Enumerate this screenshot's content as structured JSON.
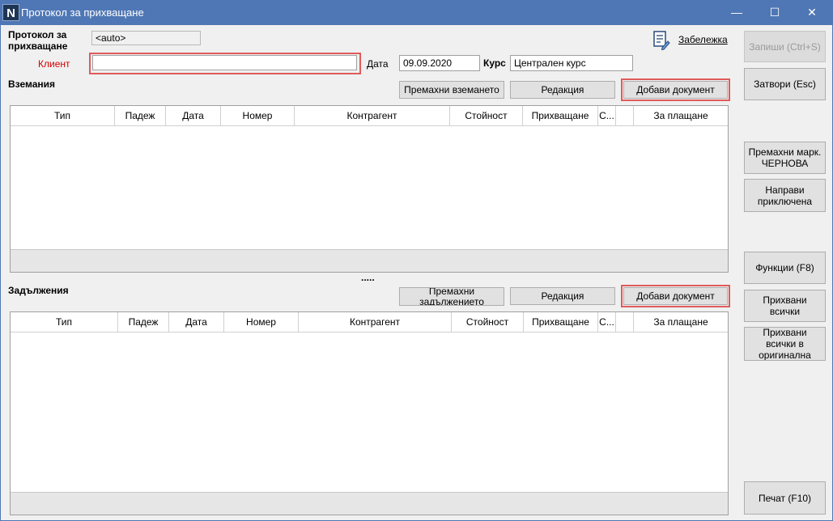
{
  "window": {
    "title": "Протокол за прихващане",
    "app_icon_letter": "N",
    "minimize_glyph": "—",
    "maximize_glyph": "☐",
    "close_glyph": "✕"
  },
  "form": {
    "protocol_label": "Протокол за прихващане",
    "protocol_value": "<auto>",
    "client_label": "Клиент",
    "client_value": "",
    "date_label": "Дата",
    "date_value": "09.09.2020",
    "rate_label": "Курс",
    "rate_value": "Централен курс",
    "note_link": "Забележка"
  },
  "receivables": {
    "section_title": "Вземания",
    "remove_button": "Премахни вземането",
    "edit_button": "Редакция",
    "add_button": "Добави документ",
    "columns": [
      "Тип",
      "Падеж",
      "Дата",
      "Номер",
      "Контрагент",
      "Стойност",
      "Прихващане",
      "С...",
      "",
      "За плащане"
    ],
    "rows": []
  },
  "splitter": {
    "grip": "....."
  },
  "payables": {
    "section_title": "Задължения",
    "remove_button": "Премахни задължението",
    "edit_button": "Редакция",
    "add_button": "Добави документ",
    "columns": [
      "Тип",
      "Падеж",
      "Дата",
      "Номер",
      "Контрагент",
      "Стойност",
      "Прихващане",
      "С...",
      "",
      "За плащане"
    ],
    "rows": []
  },
  "sidebar": {
    "save_button": "Запиши (Ctrl+S)",
    "close_button": "Затвори (Esc)",
    "remove_draft_button": "Премахни марк. ЧЕРНОВА",
    "make_final_button": "Направи приключена",
    "functions_button": "Функции (F8)",
    "offset_all_button": "Прихвани всички",
    "offset_all_original_button": "Прихвани всички в оригинална",
    "print_button": "Печат (F10)"
  },
  "colors": {
    "titlebar": "#4f77b5",
    "highlight": "#e05b5b",
    "client_label": "#d00000"
  }
}
